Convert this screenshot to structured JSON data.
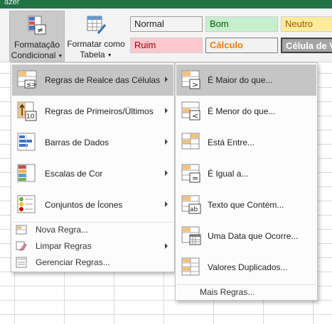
{
  "titlebar": {
    "text": "azer"
  },
  "ribbon": {
    "conditional_formatting": {
      "line1": "Formatação",
      "line2": "Condicional"
    },
    "format_as_table": {
      "line1": "Formatar como",
      "line2": "Tabela"
    },
    "cell_styles": [
      {
        "label": "Normal",
        "bg": "#ffffff",
        "fg": "#000000"
      },
      {
        "label": "Bom",
        "bg": "#c6efce",
        "fg": "#006100"
      },
      {
        "label": "Neutro",
        "bg": "#ffeb9c",
        "fg": "#9c5700"
      },
      {
        "label": "Ruim",
        "bg": "#ffc7ce",
        "fg": "#9c0006"
      },
      {
        "label": "Cálculo",
        "bg": "#f2f2f2",
        "fg": "#fa7d00"
      },
      {
        "label": "Célula de V",
        "bg": "#a5a5a5",
        "fg": "#ffffff"
      }
    ]
  },
  "main_menu": {
    "items": [
      {
        "label": "Regras de Realce das Células",
        "icon": "highlight-cells-icon",
        "highlighted": true
      },
      {
        "label": "Regras de Primeiros/Últimos",
        "icon": "top-bottom-icon"
      },
      {
        "label": "Barras de Dados",
        "icon": "data-bars-icon"
      },
      {
        "label": "Escalas de Cor",
        "icon": "color-scales-icon"
      },
      {
        "label": "Conjuntos de Ícones",
        "icon": "icon-sets-icon"
      }
    ],
    "small_items": [
      {
        "label": "Nova Regra...",
        "icon": "new-rule-icon"
      },
      {
        "label": "Limpar Regras",
        "icon": "clear-rules-icon"
      },
      {
        "label": "Gerenciar Regras...",
        "icon": "manage-rules-icon"
      }
    ]
  },
  "submenu": {
    "items": [
      {
        "label": "É Maior do que...",
        "icon": "greater-than-icon",
        "highlighted": true
      },
      {
        "label": "É Menor do que...",
        "icon": "less-than-icon"
      },
      {
        "label": "Está Entre...",
        "icon": "between-icon"
      },
      {
        "label": "É Igual a...",
        "icon": "equal-to-icon"
      },
      {
        "label": "Texto que Contém...",
        "icon": "text-contains-icon"
      },
      {
        "label": "Uma Data que Ocorre...",
        "icon": "date-occurring-icon"
      },
      {
        "label": "Valores Duplicados...",
        "icon": "duplicate-values-icon"
      }
    ],
    "more_rules": "Mais Regras..."
  },
  "colors": {
    "excel_green": "#217346",
    "menu_highlight": "#c5c5c5"
  }
}
